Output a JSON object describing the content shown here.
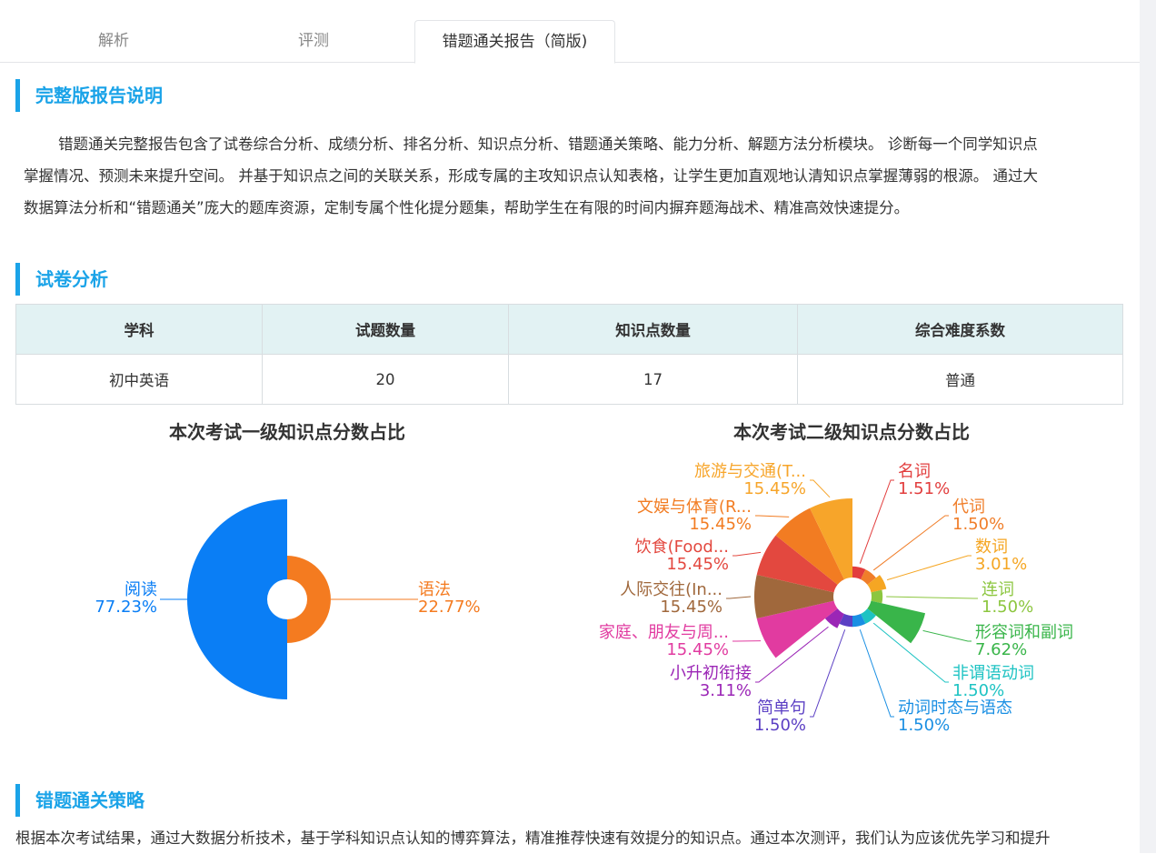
{
  "tabs": [
    {
      "label": "解析"
    },
    {
      "label": "评测"
    },
    {
      "label": "错题通关报告（简版)",
      "active": true
    }
  ],
  "full_report": {
    "title": "完整版报告说明",
    "lines": [
      "错题通关完整报告包含了试卷综合分析、成绩分析、排名分析、知识点分析、错题通关策略、能力分析、解题方法分析模块。 诊断每一个同学知识点",
      "掌握情况、预测未来提升空间。 并基于知识点之间的关联关系，形成专属的主攻知识点认知表格，让学生更加直观地认清知识点掌握薄弱的根源。 通过大",
      "数据算法分析和“错题通关”庞大的题库资源，定制专属个性化提分题集，帮助学生在有限的时间内摒弃题海战术、精准高效快速提分。"
    ]
  },
  "paper_analysis": {
    "title": "试卷分析",
    "headers": [
      "学科",
      "试题数量",
      "知识点数量",
      "综合难度系数"
    ],
    "row": [
      "初中英语",
      "20",
      "17",
      "普通"
    ]
  },
  "chart_data": [
    {
      "type": "pie",
      "title": "本次考试一级知识点分数占比",
      "rose": true,
      "slices": [
        {
          "name": "语法",
          "value": 22.77,
          "label": "22.77%",
          "color": "#f47b20"
        },
        {
          "name": "阅读",
          "value": 77.23,
          "label": "77.23%",
          "color": "#0a7ef5"
        }
      ]
    },
    {
      "type": "pie",
      "title": "本次考试二级知识点分数占比",
      "rose": true,
      "slices": [
        {
          "name": "名词",
          "value": 1.51,
          "label": "1.51%",
          "color": "#e23d3d"
        },
        {
          "name": "代词",
          "value": 1.5,
          "label": "1.50%",
          "color": "#f07e2a"
        },
        {
          "name": "数词",
          "value": 3.01,
          "label": "3.01%",
          "color": "#f5a623"
        },
        {
          "name": "连词",
          "value": 1.5,
          "label": "1.50%",
          "color": "#8cc63f"
        },
        {
          "name": "形容词和副词",
          "value": 7.62,
          "label": "7.62%",
          "color": "#39b54a"
        },
        {
          "name": "非谓语动词",
          "value": 1.5,
          "label": "1.50%",
          "color": "#1ec3c3"
        },
        {
          "name": "动词时态与语态",
          "value": 1.5,
          "label": "1.50%",
          "color": "#1a8fe3"
        },
        {
          "name": "简单句",
          "value": 1.5,
          "label": "1.50%",
          "color": "#5b3fc4"
        },
        {
          "name": "小升初衔接",
          "value": 3.11,
          "label": "3.11%",
          "color": "#9b26b6"
        },
        {
          "name": "家庭、朋友与周...",
          "value": 15.45,
          "label": "15.45%",
          "color": "#e13ba0"
        },
        {
          "name": "人际交往(In...",
          "value": 15.45,
          "label": "15.45%",
          "color": "#a0683c"
        },
        {
          "name": "饮食(Food...",
          "value": 15.45,
          "label": "15.45%",
          "color": "#e3483f"
        },
        {
          "name": "文娱与体育(R...",
          "value": 15.45,
          "label": "15.45%",
          "color": "#f27c22"
        },
        {
          "name": "旅游与交通(T...",
          "value": 15.45,
          "label": "15.45%",
          "color": "#f7a52a"
        }
      ]
    }
  ],
  "strategy": {
    "title": "错题通关策略",
    "text": "根据本次考试结果，通过大数据分析技术，基于学科知识点认知的博弈算法，精准推荐快速有效提分的知识点。通过本次测评，我们认为应该优先学习和提升"
  }
}
